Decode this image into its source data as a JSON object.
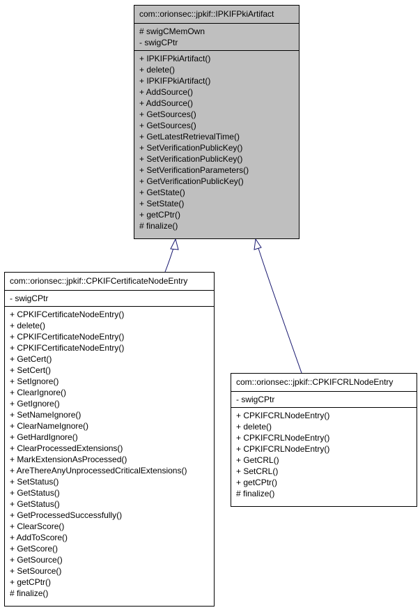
{
  "diagram": {
    "type": "inheritance",
    "classes": [
      {
        "id": "IPKIFPkiArtifact",
        "name": "com::orionsec::jpkif::IPKIFPkiArtifact",
        "highlighted": true,
        "attributes": [
          "# swigCMemOwn",
          "- swigCPtr"
        ],
        "methods": [
          "+ IPKIFPkiArtifact()",
          "+ delete()",
          "+ IPKIFPkiArtifact()",
          "+ AddSource()",
          "+ AddSource()",
          "+ GetSources()",
          "+ GetSources()",
          "+ GetLatestRetrievalTime()",
          "+ SetVerificationPublicKey()",
          "+ SetVerificationPublicKey()",
          "+ SetVerificationParameters()",
          "+ GetVerificationPublicKey()",
          "+ GetState()",
          "+ SetState()",
          "+ getCPtr()",
          "# finalize()"
        ]
      },
      {
        "id": "CPKIFCertificateNodeEntry",
        "name": "com::orionsec::jpkif::CPKIFCertificateNodeEntry",
        "highlighted": false,
        "attributes": [
          "- swigCPtr"
        ],
        "methods": [
          "+ CPKIFCertificateNodeEntry()",
          "+ delete()",
          "+ CPKIFCertificateNodeEntry()",
          "+ CPKIFCertificateNodeEntry()",
          "+ GetCert()",
          "+ SetCert()",
          "+ SetIgnore()",
          "+ ClearIgnore()",
          "+ GetIgnore()",
          "+ SetNameIgnore()",
          "+ ClearNameIgnore()",
          "+ GetHardIgnore()",
          "+ ClearProcessedExtensions()",
          "+ MarkExtensionAsProcessed()",
          "+ AreThereAnyUnprocessedCriticalExtensions()",
          "+ SetStatus()",
          "+ GetStatus()",
          "+ GetStatus()",
          "+ GetProcessedSuccessfully()",
          "+ ClearScore()",
          "+ AddToScore()",
          "+ GetScore()",
          "+ GetSource()",
          "+ SetSource()",
          "+ getCPtr()",
          "# finalize()"
        ]
      },
      {
        "id": "CPKIFCRLNodeEntry",
        "name": "com::orionsec::jpkif::CPKIFCRLNodeEntry",
        "highlighted": false,
        "attributes": [
          "- swigCPtr"
        ],
        "methods": [
          "+ CPKIFCRLNodeEntry()",
          "+ delete()",
          "+ CPKIFCRLNodeEntry()",
          "+ CPKIFCRLNodeEntry()",
          "+ GetCRL()",
          "+ SetCRL()",
          "+ getCPtr()",
          "# finalize()"
        ]
      }
    ],
    "edges": [
      {
        "from": "CPKIFCertificateNodeEntry",
        "to": "IPKIFPkiArtifact",
        "kind": "generalization"
      },
      {
        "from": "CPKIFCRLNodeEntry",
        "to": "IPKIFPkiArtifact",
        "kind": "generalization"
      }
    ],
    "colors": {
      "highlight_fill": "#bfbfbf",
      "box_fill": "#ffffff",
      "border": "#000000",
      "edge": "#191970"
    }
  }
}
